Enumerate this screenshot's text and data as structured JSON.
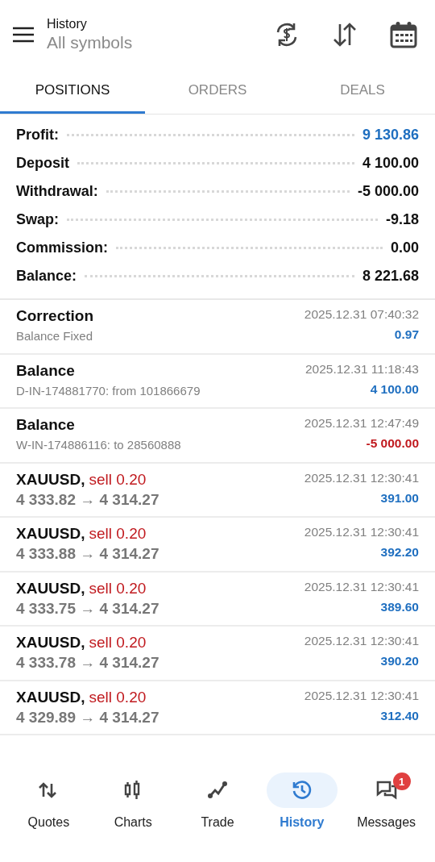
{
  "header": {
    "title": "History",
    "subtitle": "All symbols"
  },
  "tabs": [
    {
      "label": "POSITIONS",
      "selected": true
    },
    {
      "label": "ORDERS",
      "selected": false
    },
    {
      "label": "DEALS",
      "selected": false
    }
  ],
  "summary": [
    {
      "label": "Profit:",
      "value": "9 130.86",
      "color": "#1f6fc0"
    },
    {
      "label": "Deposit",
      "value": "4 100.00",
      "color": "#111111"
    },
    {
      "label": "Withdrawal:",
      "value": "-5 000.00",
      "color": "#111111"
    },
    {
      "label": "Swap:",
      "value": "-9.18",
      "color": "#111111"
    },
    {
      "label": "Commission:",
      "value": "0.00",
      "color": "#111111"
    },
    {
      "label": "Balance:",
      "value": "8 221.68",
      "color": "#111111"
    }
  ],
  "deals": [
    {
      "kind": "balance",
      "title": "Correction",
      "comment": "Balance Fixed",
      "time": "2025.12.31 07:40:32",
      "amount": "0.97",
      "color": "#1f6fc0"
    },
    {
      "kind": "balance",
      "title": "Balance",
      "comment": "D-IN-174881770: from 101866679",
      "time": "2025.12.31 11:18:43",
      "amount": "4 100.00",
      "color": "#1f6fc0"
    },
    {
      "kind": "balance",
      "title": "Balance",
      "comment": "W-IN-174886116: to 28560888",
      "time": "2025.12.31 12:47:49",
      "amount": "-5 000.00",
      "color": "#c0191e"
    },
    {
      "kind": "trade",
      "title": "XAUUSD,",
      "side": "sell 0.20",
      "prices": "4 333.82 → 4 314.27",
      "time": "2025.12.31 12:30:41",
      "amount": "391.00",
      "color": "#1f6fc0"
    },
    {
      "kind": "trade",
      "title": "XAUUSD,",
      "side": "sell 0.20",
      "prices": "4 333.88 → 4 314.27",
      "time": "2025.12.31 12:30:41",
      "amount": "392.20",
      "color": "#1f6fc0"
    },
    {
      "kind": "trade",
      "title": "XAUUSD,",
      "side": "sell 0.20",
      "prices": "4 333.75 → 4 314.27",
      "time": "2025.12.31 12:30:41",
      "amount": "389.60",
      "color": "#1f6fc0"
    },
    {
      "kind": "trade",
      "title": "XAUUSD,",
      "side": "sell 0.20",
      "prices": "4 333.78 → 4 314.27",
      "time": "2025.12.31 12:30:41",
      "amount": "390.20",
      "color": "#1f6fc0"
    },
    {
      "kind": "trade",
      "title": "XAUUSD,",
      "side": "sell 0.20",
      "prices": "4 329.89 → 4 314.27",
      "time": "2025.12.31 12:30:41",
      "amount": "312.40",
      "color": "#1f6fc0"
    }
  ],
  "nav": [
    {
      "label": "Quotes",
      "selected": false
    },
    {
      "label": "Charts",
      "selected": false
    },
    {
      "label": "Trade",
      "selected": false
    },
    {
      "label": "History",
      "selected": true
    },
    {
      "label": "Messages",
      "selected": false,
      "badge": "1"
    }
  ]
}
